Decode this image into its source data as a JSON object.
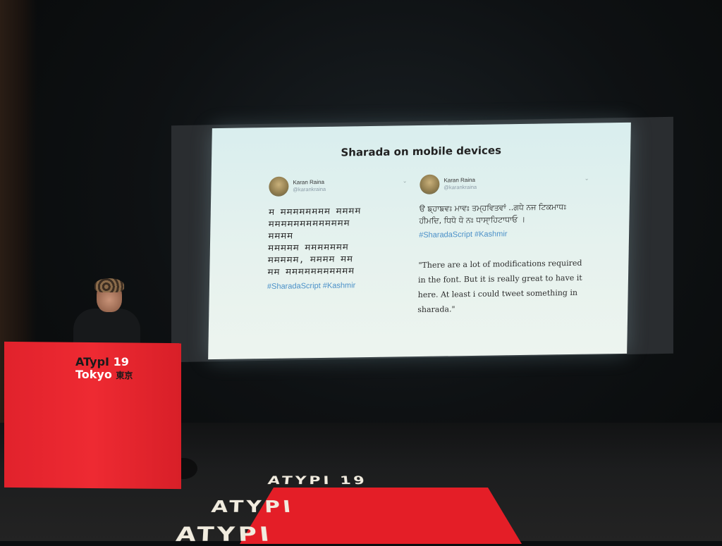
{
  "slide": {
    "title": "Sharada on mobile devices",
    "tweet_left": {
      "name": "Karan Raina",
      "handle": "@karankraina",
      "body": "𑆯 𑆯𑆯𑆯𑆯𑆯𑆯𑆯𑆯 𑆯𑆯𑆯𑆯\n𑆯𑆯𑆯𑆯𑆯𑆯𑆯𑆯𑆯𑆯𑆯𑆯𑆯\n𑆯𑆯𑆯𑆯\n𑆯𑆯𑆯𑆯𑆯 𑆯𑆯𑆯𑆯𑆯𑆯𑆯\n𑆯𑆯𑆯𑆯𑆯, 𑆯𑆯𑆯𑆯 𑆯𑆯\n𑆯𑆯 𑆯𑆯𑆯𑆯𑆯𑆯𑆯𑆯𑆯𑆯𑆯",
      "hashtags": "#SharadaScript #Kashmir"
    },
    "tweet_right": {
      "name": "Karan Raina",
      "handle": "@karankraina",
      "body": "ੳ ਙ੍ਹਾਙਵਃ ਮਾਵਃ ਤਮ੍ਹਵਿਤਵਾਂ ..ਗਧੇ ਨਜ ਟਿਕਮਾਧਃ ਹੀਮਦਿ, ਧਿਧੋ ਧੋ ਨਃ ਧਾਸਾ੍ਹਿਟਾਧਾਓ ।",
      "hashtags": "#SharadaScript #Kashmir",
      "quote": "\"There are a lot of modifications required in the font. But it is really great to have it here. At least i could tweet something in sharada.\""
    }
  },
  "podium": {
    "brand": "ATypI",
    "year": "19",
    "city": "Tokyo",
    "kanji": "東京"
  },
  "floor_logo": {
    "line1": "ATYPI 19",
    "line2": "ATYPI",
    "line3": "ATYPI"
  },
  "colors": {
    "brand_red": "#e41e27",
    "slide_bg": "#dff0ee",
    "hashtag": "#4a90c8"
  }
}
